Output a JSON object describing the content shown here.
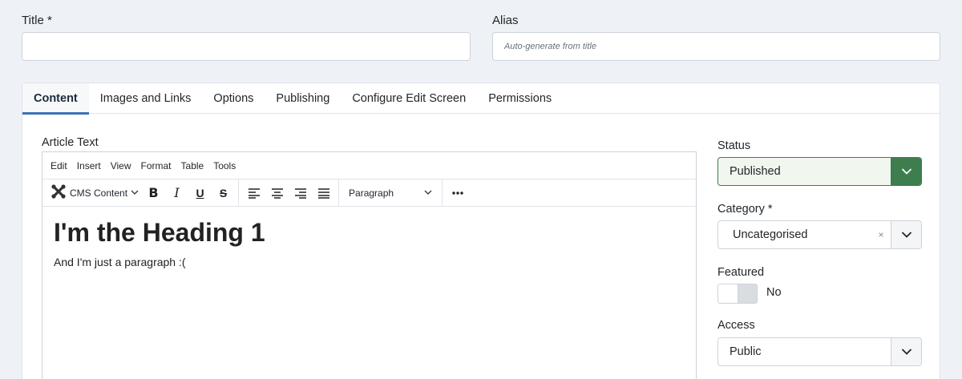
{
  "title_field": {
    "label": "Title *",
    "value": "",
    "placeholder": ""
  },
  "alias_field": {
    "label": "Alias",
    "value": "",
    "placeholder": "Auto-generate from title"
  },
  "tabs": [
    {
      "label": "Content",
      "active": true
    },
    {
      "label": "Images and Links",
      "active": false
    },
    {
      "label": "Options",
      "active": false
    },
    {
      "label": "Publishing",
      "active": false
    },
    {
      "label": "Configure Edit Screen",
      "active": false
    },
    {
      "label": "Permissions",
      "active": false
    }
  ],
  "editor": {
    "label": "Article Text",
    "menu": [
      "Edit",
      "Insert",
      "View",
      "Format",
      "Table",
      "Tools"
    ],
    "cms_content_label": "CMS Content",
    "block_format": "Paragraph",
    "heading": "I'm the Heading 1",
    "paragraph": "And I'm just a paragraph :("
  },
  "status": {
    "label": "Status",
    "value": "Published",
    "color": "#3d7d4e"
  },
  "category": {
    "label": "Category *",
    "value": "Uncategorised"
  },
  "featured": {
    "label": "Featured",
    "value": "No"
  },
  "access": {
    "label": "Access",
    "value": "Public"
  },
  "colors": {
    "page_bg": "#eef2f6",
    "active_tab_indicator": "#3b72b8",
    "status_accent": "#3d7d4e"
  }
}
